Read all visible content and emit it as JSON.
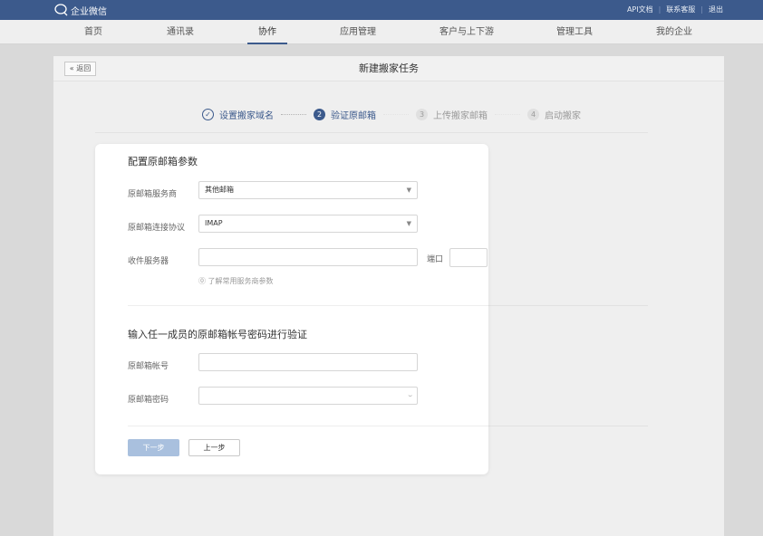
{
  "topbar": {
    "logo_text": "企业微信",
    "links": [
      "API文档",
      "联系客服",
      "退出"
    ],
    "bg_color": "#3c5a8c"
  },
  "nav": {
    "items": [
      "首页",
      "通讯录",
      "协作",
      "应用管理",
      "客户与上下游",
      "管理工具",
      "我的企业"
    ],
    "active": "协作"
  },
  "panel": {
    "back_label": "« 返回",
    "title": "新建搬家任务"
  },
  "steps": [
    {
      "number": "✓",
      "label": "设置搬家域名",
      "state": "done"
    },
    {
      "number": "2",
      "label": "验证原邮箱",
      "state": "current"
    },
    {
      "number": "3",
      "label": "上传搬家邮箱",
      "state": "todo"
    },
    {
      "number": "4",
      "label": "启动搬家",
      "state": "todo"
    }
  ],
  "config": {
    "title": "配置原邮箱参数",
    "provider_label": "原邮箱服务商",
    "provider_value": "其他邮箱",
    "protocol_label": "原邮箱连接协议",
    "protocol_value": "IMAP",
    "server_label": "收件服务器",
    "server_value": "",
    "port_label": "端口",
    "port_value": "",
    "hint": "⓪ 了解常用服务商参数"
  },
  "verify": {
    "title": "输入任一成员的原邮箱帐号密码进行验证",
    "account_label": "原邮箱帐号",
    "account_value": "",
    "password_label": "原邮箱密码",
    "password_value": ""
  },
  "buttons": {
    "next": "下一步",
    "prev": "上一步"
  },
  "icons": {
    "dropdown": "chevron-down-icon",
    "password_toggle": "eye-closed-icon"
  }
}
